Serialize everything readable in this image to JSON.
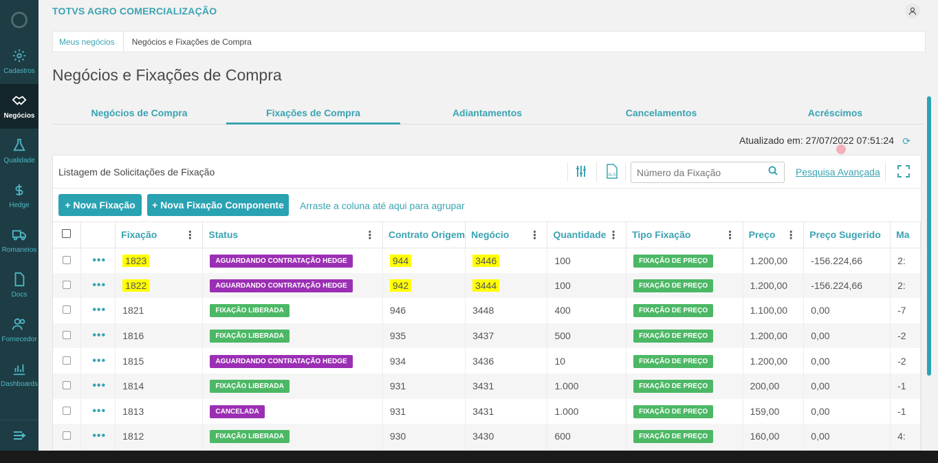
{
  "company": "TOTVS AGRO COMERCIALIZAÇÃO",
  "sidebar": {
    "items": [
      {
        "label": "Cadastros"
      },
      {
        "label": "Negócios"
      },
      {
        "label": "Qualidade"
      },
      {
        "label": "Hedge"
      },
      {
        "label": "Romaneios"
      },
      {
        "label": "Docs"
      },
      {
        "label": "Fornecedor"
      },
      {
        "label": "Dashboards"
      }
    ]
  },
  "breadcrumb": [
    "Meus negócios",
    "Negócios e Fixações de Compra"
  ],
  "page_title": "Negócios e Fixações de Compra",
  "tabs": [
    "Negócios de Compra",
    "Fixações de Compra",
    "Adiantamentos",
    "Cancelamentos",
    "Acréscimos"
  ],
  "updated": "Atualizado em: 27/07/2022 07:51:24",
  "panel": {
    "title": "Listagem de Solicitações de Fixação",
    "search_placeholder": "Número da Fixação",
    "advanced_search": "Pesquisa Avançada",
    "btn_new": "+ Nova Fixação",
    "btn_new_component": "+ Nova Fixação Componente",
    "group_hint": "Arraste a coluna até aqui para agrupar"
  },
  "columns": [
    "Fixação",
    "Status",
    "Contrato Origem",
    "Negócio",
    "Quantidade",
    "Tipo Fixação",
    "Preço",
    "Preço Sugerido",
    "Ma"
  ],
  "rows": [
    {
      "fixacao": "1823",
      "status": "AGUARDANDO CONTRATAÇÃO HEDGE",
      "contrato": "944",
      "negocio": "3446",
      "quantidade": "100",
      "tipo": "FIXAÇÃO DE PREÇO",
      "preco": "1.200,00",
      "sugerido": "-156.224,66",
      "ma": "2:",
      "highlight": true
    },
    {
      "fixacao": "1822",
      "status": "AGUARDANDO CONTRATAÇÃO HEDGE",
      "contrato": "942",
      "negocio": "3444",
      "quantidade": "100",
      "tipo": "FIXAÇÃO DE PREÇO",
      "preco": "1.200,00",
      "sugerido": "-156.224,66",
      "ma": "2:",
      "highlight": true
    },
    {
      "fixacao": "1821",
      "status": "FIXAÇÃO LIBERADA",
      "contrato": "946",
      "negocio": "3448",
      "quantidade": "400",
      "tipo": "FIXAÇÃO DE PREÇO",
      "preco": "1.100,00",
      "sugerido": "0,00",
      "ma": "-7",
      "highlight": false
    },
    {
      "fixacao": "1816",
      "status": "FIXAÇÃO LIBERADA",
      "contrato": "935",
      "negocio": "3437",
      "quantidade": "500",
      "tipo": "FIXAÇÃO DE PREÇO",
      "preco": "1.200,00",
      "sugerido": "0,00",
      "ma": "-2",
      "highlight": false
    },
    {
      "fixacao": "1815",
      "status": "AGUARDANDO CONTRATAÇÃO HEDGE",
      "contrato": "934",
      "negocio": "3436",
      "quantidade": "10",
      "tipo": "FIXAÇÃO DE PREÇO",
      "preco": "1.200,00",
      "sugerido": "0,00",
      "ma": "-2",
      "highlight": false
    },
    {
      "fixacao": "1814",
      "status": "FIXAÇÃO LIBERADA",
      "contrato": "931",
      "negocio": "3431",
      "quantidade": "1.000",
      "tipo": "FIXAÇÃO DE PREÇO",
      "preco": "200,00",
      "sugerido": "0,00",
      "ma": "-1",
      "highlight": false
    },
    {
      "fixacao": "1813",
      "status": "CANCELADA",
      "contrato": "931",
      "negocio": "3431",
      "quantidade": "1.000",
      "tipo": "FIXAÇÃO DE PREÇO",
      "preco": "159,00",
      "sugerido": "0,00",
      "ma": "-1",
      "highlight": false
    },
    {
      "fixacao": "1812",
      "status": "FIXAÇÃO LIBERADA",
      "contrato": "930",
      "negocio": "3430",
      "quantidade": "600",
      "tipo": "FIXAÇÃO DE PREÇO",
      "preco": "160,00",
      "sugerido": "0,00",
      "ma": "4:",
      "highlight": false
    }
  ],
  "colors": {
    "accent": "#3aa3b2",
    "sidebar": "#1d3c44",
    "status_purple": "#9b2fb4",
    "status_green": "#4cb865",
    "highlight": "#ffff00"
  }
}
